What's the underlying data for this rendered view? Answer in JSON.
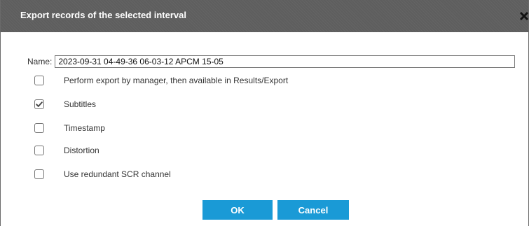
{
  "dialog": {
    "title": "Export records of the selected interval",
    "close_icon": "close-icon"
  },
  "form": {
    "name_label": "Name:",
    "name_value": "2023-09-31 04-49-36 06-03-12 APCM 15-05"
  },
  "options": [
    {
      "label": "Perform export by manager, then available in Results/Export",
      "checked": false
    },
    {
      "label": "Subtitles",
      "checked": true
    },
    {
      "label": "Timestamp",
      "checked": false
    },
    {
      "label": "Distortion",
      "checked": false
    },
    {
      "label": "Use redundant SCR channel",
      "checked": false
    }
  ],
  "buttons": {
    "ok_label": "OK",
    "cancel_label": "Cancel"
  },
  "colors": {
    "title_bar": "#5e5e5e",
    "button": "#1a9ad6"
  }
}
